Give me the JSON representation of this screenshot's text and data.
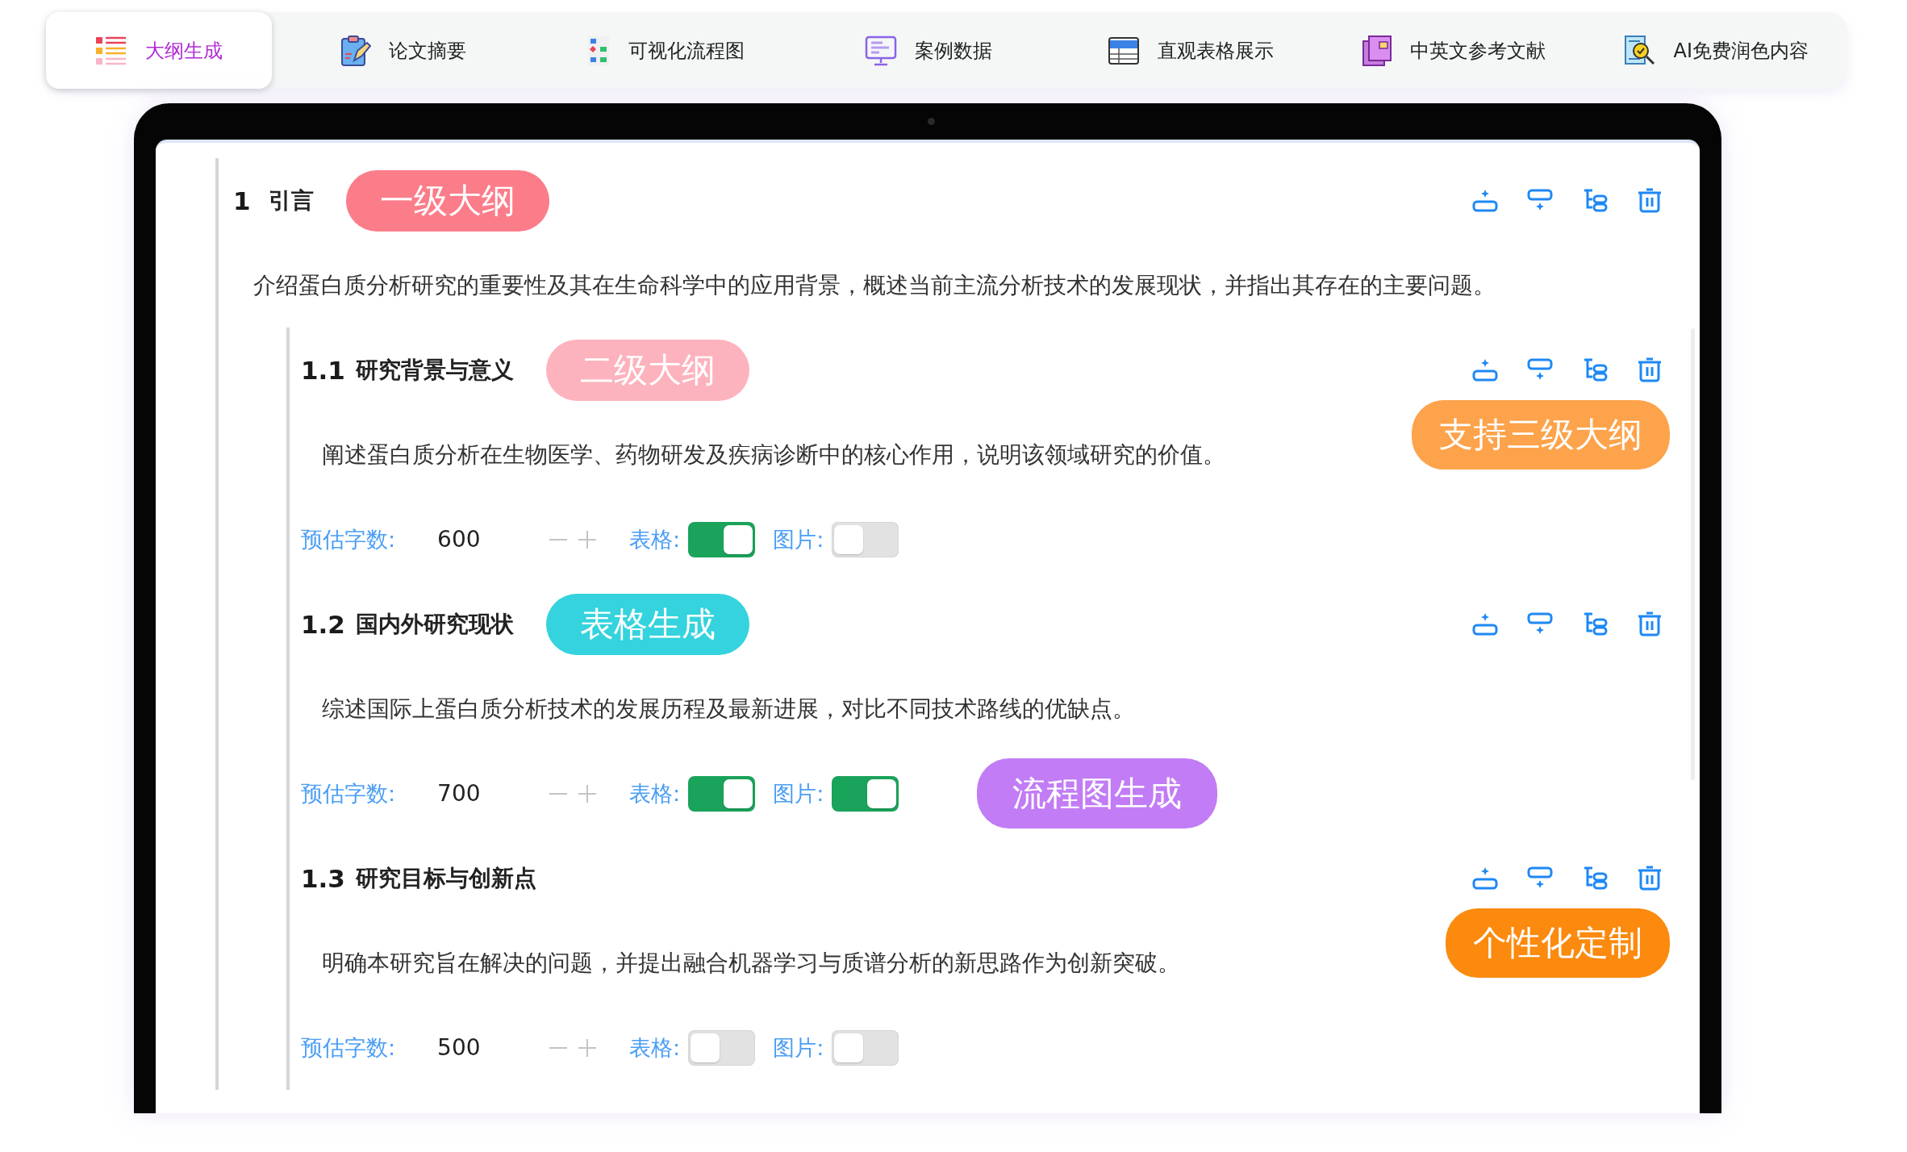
{
  "tabs": [
    {
      "label": "大纲生成",
      "selected": true
    },
    {
      "label": "论文摘要",
      "selected": false
    },
    {
      "label": "可视化流程图",
      "selected": false
    },
    {
      "label": "案例数据",
      "selected": false
    },
    {
      "label": "直观表格展示",
      "selected": false
    },
    {
      "label": "中英文参考文献",
      "selected": false
    },
    {
      "label": "AI免费润色内容",
      "selected": false
    }
  ],
  "sections": [
    {
      "number": "1",
      "title": "引言",
      "tag": {
        "text": "一级大纲",
        "color": "#fb7d8a"
      },
      "description": "介绍蛋白质分析研究的重要性及其在生命科学中的应用背景，概述当前主流分析技术的发展现状，并指出其存在的主要问题。",
      "children": [
        {
          "number": "1.1",
          "title": "研究背景与意义",
          "tag": {
            "text": "二级大纲",
            "color": "#fdb3bd"
          },
          "side_tag": {
            "text": "支持三级大纲",
            "color": "#fda34b"
          },
          "description": "阐述蛋白质分析在生物医学、药物研发及疾病诊断中的核心作用，说明该领域研究的价值。",
          "word_count_label": "预估字数:",
          "word_count": "600",
          "table_label": "表格:",
          "table_on": true,
          "image_label": "图片:",
          "image_on": false
        },
        {
          "number": "1.2",
          "title": "国内外研究现状",
          "tag": {
            "text": "表格生成",
            "color": "#34d3de"
          },
          "description": "综述国际上蛋白质分析技术的发展历程及最新进展，对比不同技术路线的优缺点。",
          "word_count_label": "预估字数:",
          "word_count": "700",
          "table_label": "表格:",
          "table_on": true,
          "image_label": "图片:",
          "image_on": true,
          "controls_tag": {
            "text": "流程图生成",
            "color": "#c27cf5"
          }
        },
        {
          "number": "1.3",
          "title": "研究目标与创新点",
          "side_tag": {
            "text": "个性化定制",
            "color": "#fb8a0e"
          },
          "description": "明确本研究旨在解决的问题，并提出融合机器学习与质谱分析的新思路作为创新突破。",
          "word_count_label": "预估字数:",
          "word_count": "500",
          "table_label": "表格:",
          "table_on": false,
          "image_label": "图片:",
          "image_on": false
        }
      ]
    }
  ]
}
